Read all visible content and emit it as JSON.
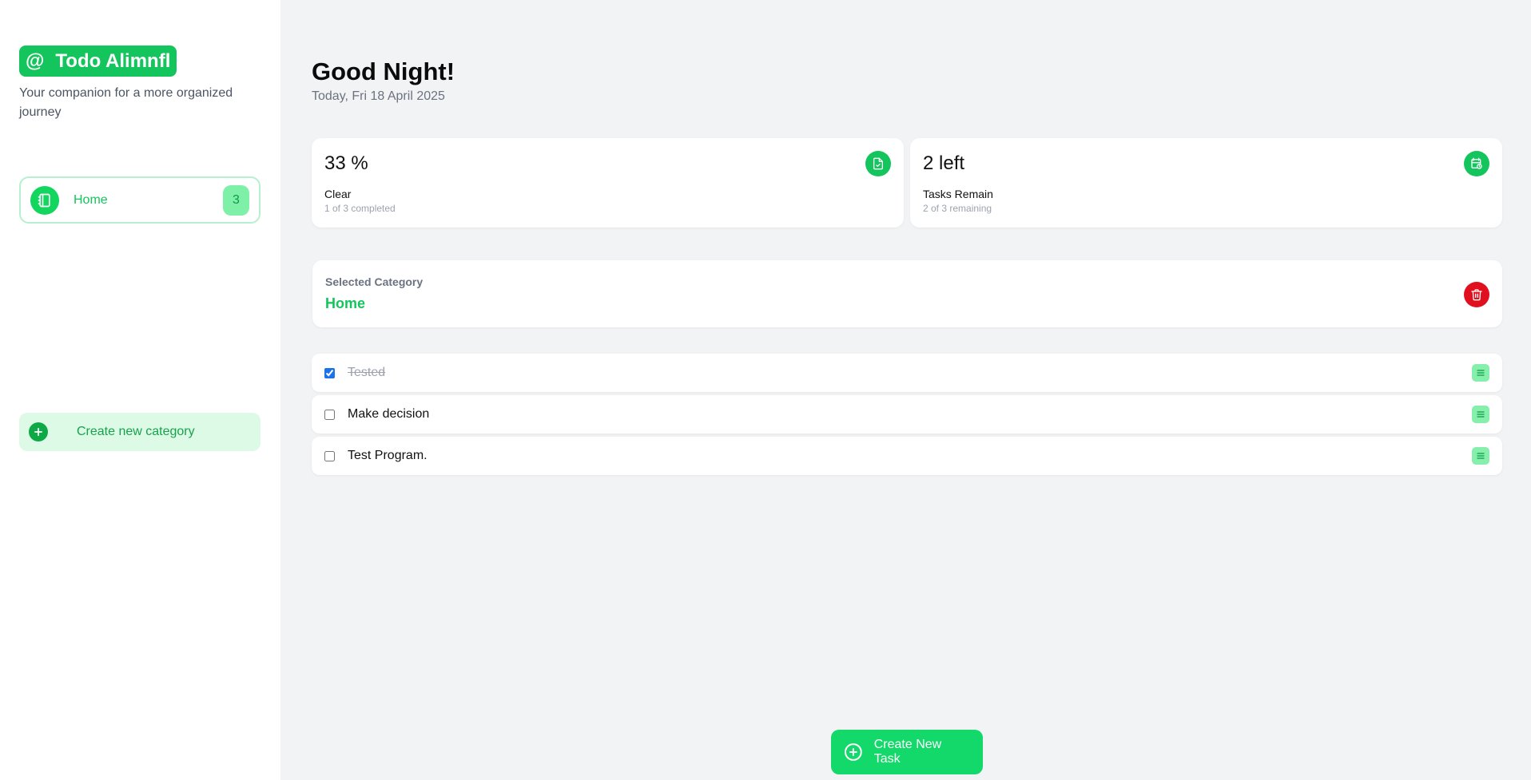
{
  "app": {
    "brand_symbol": "@",
    "title": "Todo Alimnfl",
    "tagline": "Your companion for a more organized journey"
  },
  "sidebar": {
    "categories": [
      {
        "label": "Home",
        "count": "3",
        "icon": "notebook-icon"
      }
    ],
    "create_category_label": "Create new category"
  },
  "header": {
    "greeting": "Good Night!",
    "date": "Today, Fri 18 April 2025"
  },
  "stats": [
    {
      "value": "33 %",
      "label": "Clear",
      "sub": "1 of 3 completed",
      "icon": "file-check-icon"
    },
    {
      "value": "2 left",
      "label": "Tasks Remain",
      "sub": "2 of 3 remaining",
      "icon": "calendar-clock-icon"
    }
  ],
  "selected_category": {
    "label": "Selected Category",
    "value": "Home"
  },
  "tasks": [
    {
      "name": "Tested",
      "done": true
    },
    {
      "name": "Make decision",
      "done": false
    },
    {
      "name": "Test Program.",
      "done": false
    }
  ],
  "create_task_label": "Create New Task",
  "colors": {
    "accent": "#13c55c",
    "accent_light": "#dcfae6",
    "danger": "#e0101e",
    "background": "#f2f3f5"
  }
}
